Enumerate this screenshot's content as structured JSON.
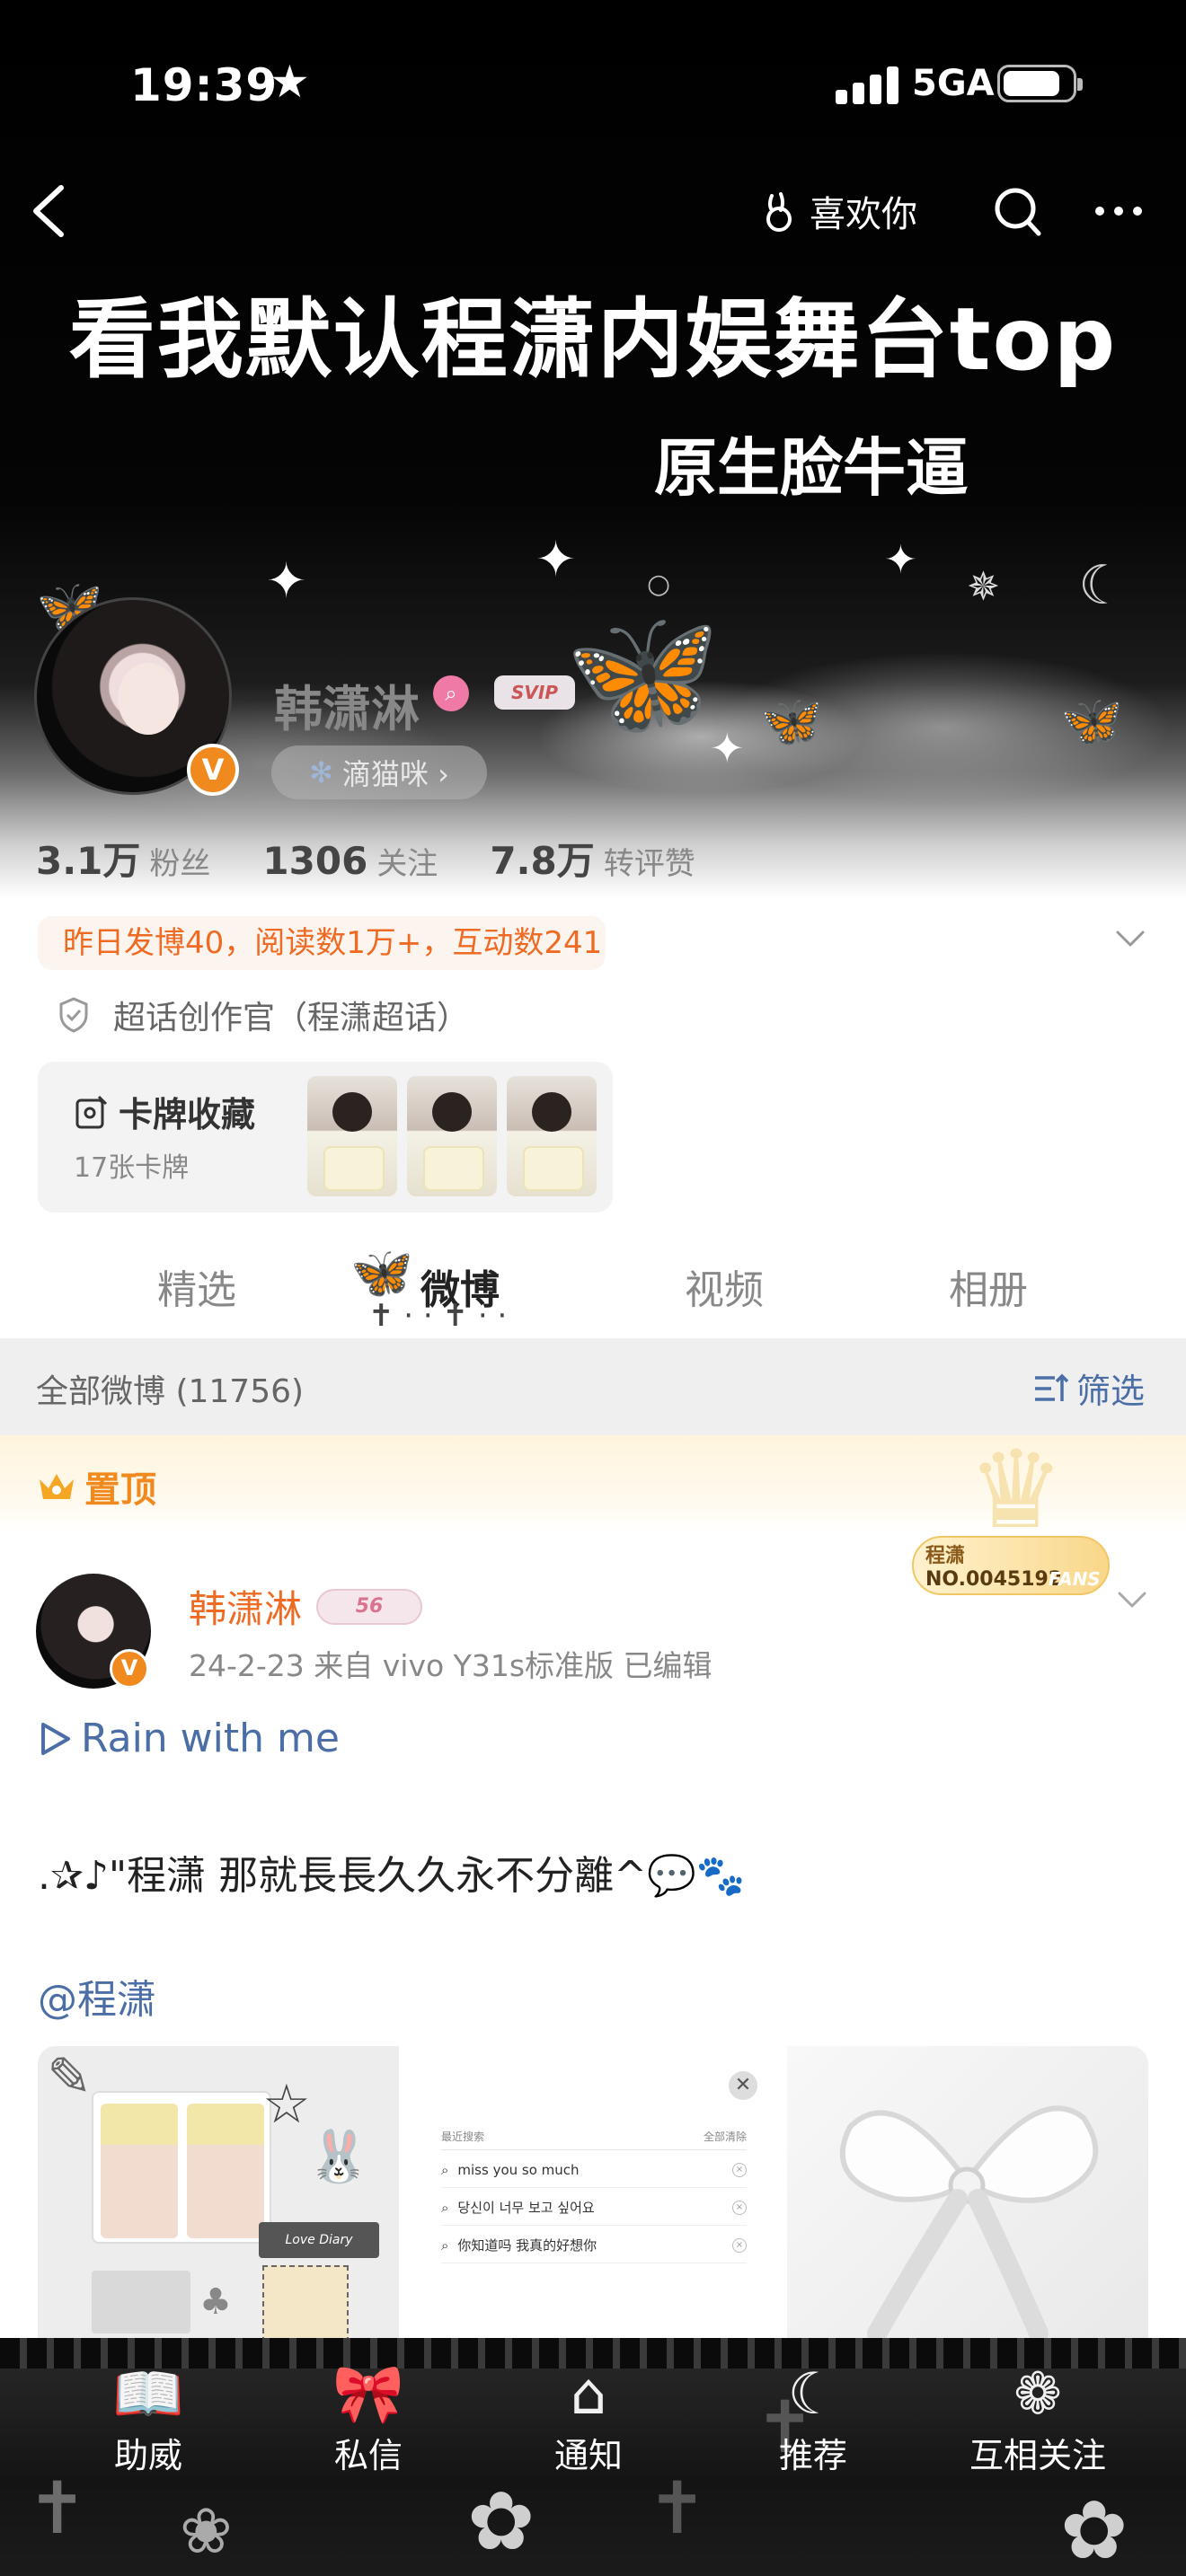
{
  "status_bar": {
    "time": "19:39",
    "network": "5GA"
  },
  "nav": {
    "like_label": "喜欢你"
  },
  "banner": {
    "title": "看我默认程潇内娱舞台top",
    "subtitle": "原生脸牛逼"
  },
  "profile": {
    "name": "韩潇淋",
    "svip": "SVIP",
    "nickname_pill": "滴猫咪 ›",
    "stats": [
      {
        "value": "3.1万",
        "label": "粉丝"
      },
      {
        "value": "1306",
        "label": "关注"
      },
      {
        "value": "7.8万",
        "label": "转评赞"
      }
    ],
    "activity": "昨日发博40，阅读数1万+，互动数241",
    "supertopic": "超话创作官（程潇超话）",
    "cards": {
      "title": "卡牌收藏",
      "count": "17张卡牌"
    }
  },
  "tabs": [
    "精选",
    "微博",
    "视频",
    "相册"
  ],
  "active_tab": "微博",
  "filter": {
    "label": "全部微博 (11756)",
    "action": "筛选"
  },
  "pinned": {
    "label": "置顶",
    "fans_badge": {
      "name": "程潇",
      "number": "NO.0045192",
      "word": "FANS"
    }
  },
  "post": {
    "author": "韩潇淋",
    "level": "56",
    "meta": "24-2-23  来自 vivo Y31s标准版  已编辑",
    "music": "Rain with me",
    "text": ".✰♪\"程潇 那就長長久久永不分離^💬🐾",
    "mention": "@程潇",
    "images": {
      "diary_label": "Love Diary",
      "search_panel": {
        "header_left": "最近搜索",
        "header_right": "全部清除",
        "rows": [
          "miss you so much",
          "당신이 너무 보고 싶어요",
          "你知道吗 我真的好想你"
        ]
      }
    }
  },
  "bottom_bar": [
    "助威",
    "私信",
    "通知",
    "推荐",
    "互相关注"
  ],
  "colors": {
    "accent_orange": "#ef6b23",
    "link_blue": "#4a6ea5",
    "vip_orange": "#f08a1e"
  }
}
